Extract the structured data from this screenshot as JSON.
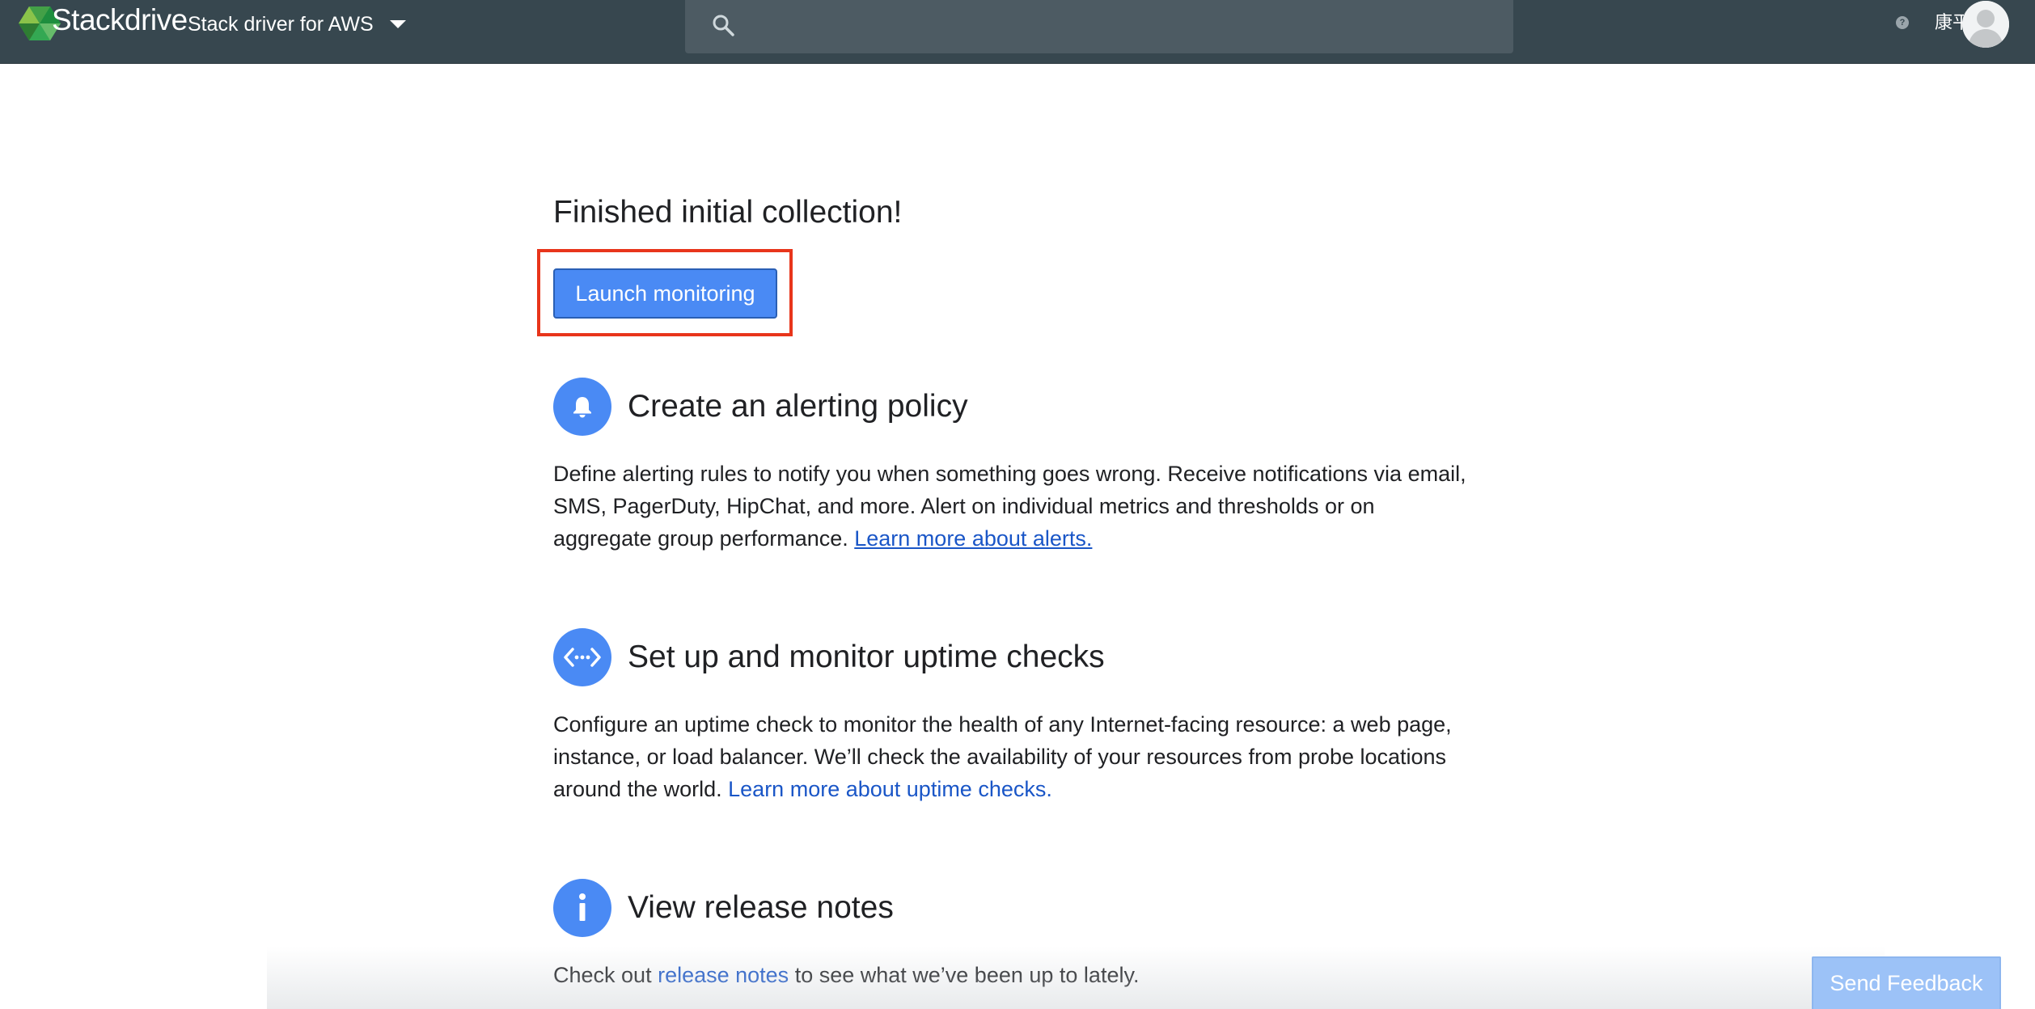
{
  "topbar": {
    "brand_name": "Stackdriver",
    "project_name": "Stack driver for AWS",
    "search_placeholder": "",
    "help_glyph": "?",
    "user_name": "康平",
    "colors": {
      "bar": "#37474f",
      "search": "#4d5b63"
    }
  },
  "main": {
    "title": "Finished initial collection!",
    "launch_label": "Launch monitoring",
    "sections": [
      {
        "icon": "bell-icon",
        "title": "Create an alerting policy",
        "body": "Define alerting rules to notify you when something goes wrong. Receive notifications via email, SMS, PagerDuty, HipChat, and more. Alert on individual metrics and thresholds or on aggregate group performance. ",
        "link": "Learn more about alerts."
      },
      {
        "icon": "uptime-check-icon",
        "title": "Set up and monitor uptime checks",
        "body": "Configure an uptime check to monitor the health of any Internet-facing resource: a web page, instance, or load balancer. We’ll check the availability of your resources from probe locations around the world. ",
        "link": "Learn more about uptime checks."
      },
      {
        "icon": "info-icon",
        "title": "View release notes",
        "body_before": "Check out ",
        "link": "release notes",
        "body_after": " to see what we’ve been up to lately."
      }
    ]
  },
  "feedback": {
    "label": "Send Feedback"
  },
  "colors": {
    "accent": "#4a8af4",
    "link": "#1a56c7",
    "highlight": "#e8351b"
  }
}
